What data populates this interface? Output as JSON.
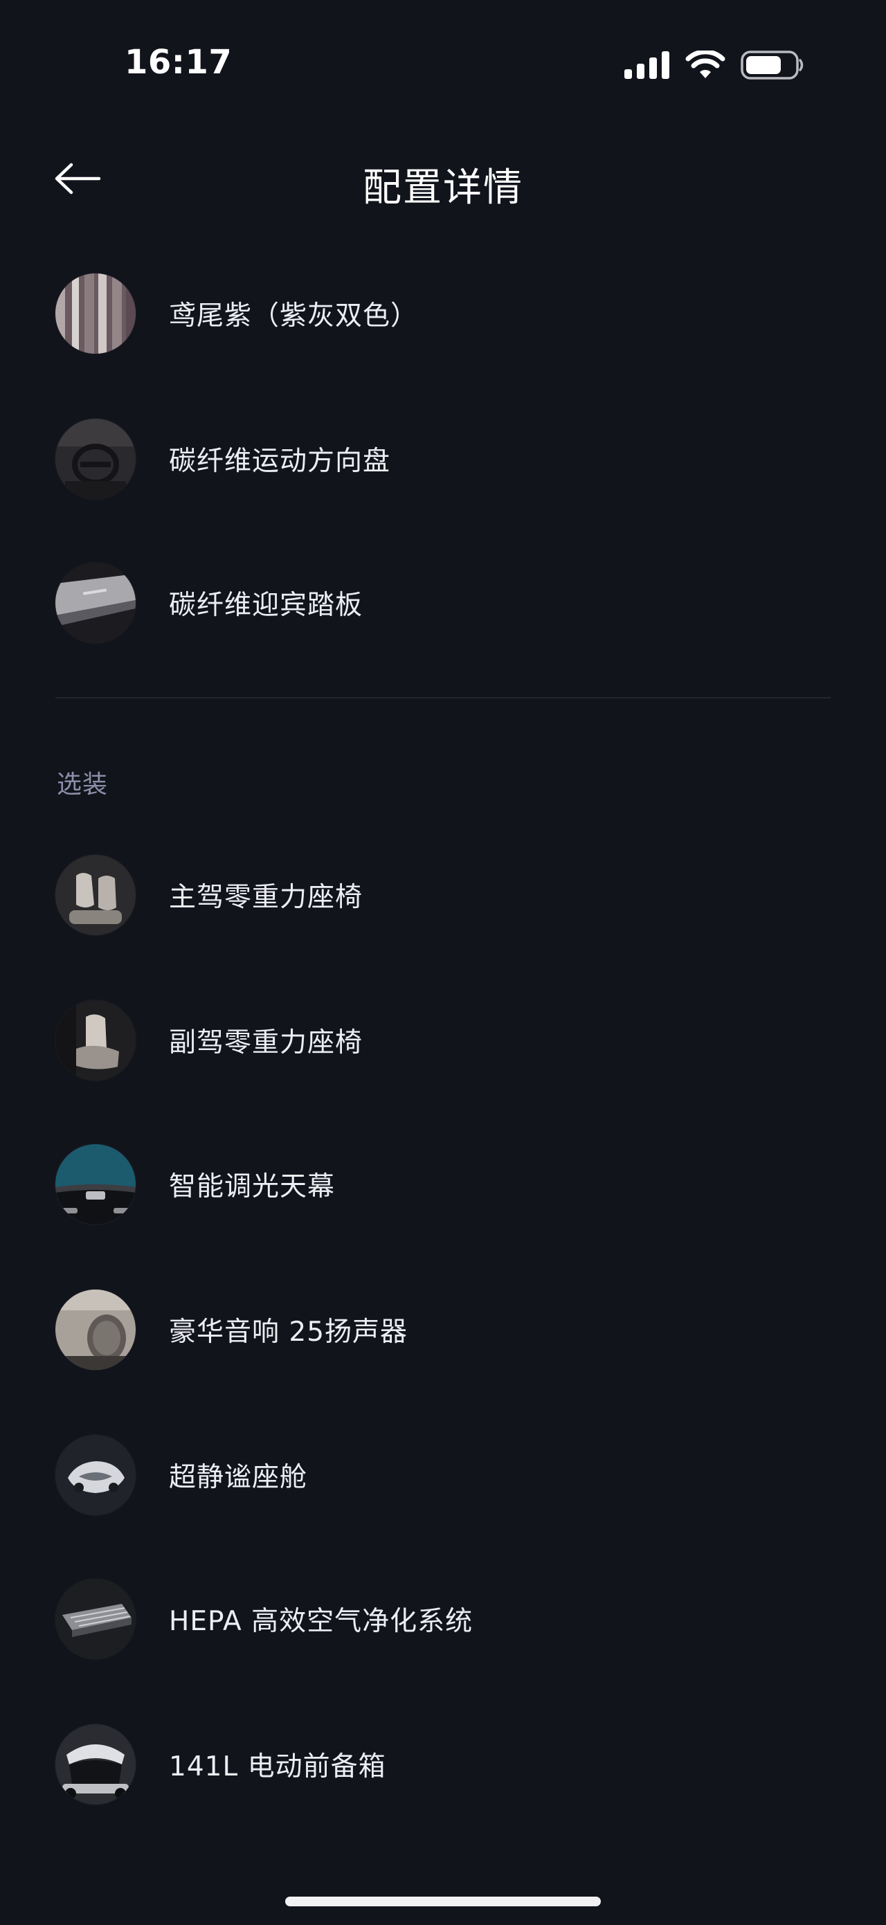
{
  "status_bar": {
    "time": "16:17",
    "icons": [
      "cellular-signal-icon",
      "wifi-icon",
      "battery-icon"
    ]
  },
  "nav": {
    "title": "配置详情",
    "back_icon": "arrow-left-icon"
  },
  "standard_items": [
    {
      "label": "鸢尾紫（紫灰双色）",
      "thumb": "interior-color-swatch"
    },
    {
      "label": "碳纤维运动方向盘",
      "thumb": "steering-wheel-photo"
    },
    {
      "label": "碳纤维迎宾踏板",
      "thumb": "door-sill-photo"
    }
  ],
  "optional_section": {
    "title": "选装",
    "items": [
      {
        "label": "主驾零重力座椅",
        "thumb": "driver-seat-photo"
      },
      {
        "label": "副驾零重力座椅",
        "thumb": "passenger-seat-photo"
      },
      {
        "label": "智能调光天幕",
        "thumb": "sky-roof-photo"
      },
      {
        "label": "豪华音响 25扬声器",
        "thumb": "speaker-photo"
      },
      {
        "label": "超静谧座舱",
        "thumb": "quiet-cabin-photo"
      },
      {
        "label": "HEPA 高效空气净化系统",
        "thumb": "air-filter-photo"
      },
      {
        "label": "141L 电动前备箱",
        "thumb": "front-trunk-photo"
      }
    ]
  },
  "colors": {
    "background": "#12141c",
    "text_primary": "#eceef2",
    "text_section": "#8d8fa8",
    "divider": "#23262f"
  }
}
